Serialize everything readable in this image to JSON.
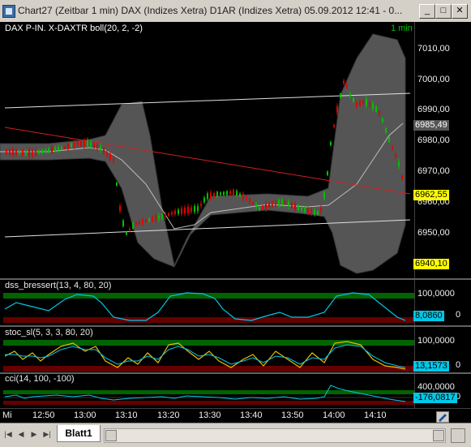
{
  "window": {
    "title": "Chart27 (Zeitbar 1 min)  DAX (Indizes Xetra) D1AR (Indizes Xetra) 05.09.2012 12:41 - 0...",
    "min_glyph": "_",
    "max_glyph": "□",
    "close_glyph": "✕"
  },
  "main_pane": {
    "label": "DAX P-IN. X-DAXTR boll(20, 2, -2)",
    "interval": "1 min",
    "ticks": [
      "7010,00",
      "7000,00",
      "6990,00",
      "6980,00",
      "6970,00",
      "6960,00",
      "6950,00"
    ],
    "flags": {
      "upper": "6985,49",
      "last": "6962,55",
      "lower": "6940,10"
    }
  },
  "dss_pane": {
    "label": "dss_bressert(13, 4, 80, 20)",
    "ticks": [
      "100,0000",
      "0"
    ],
    "value": "8,0860"
  },
  "stoc_pane": {
    "label": "stoc_sl(5, 3, 3, 80, 20)",
    "ticks": [
      "100,0000",
      "0"
    ],
    "value": "13,1573"
  },
  "cci_pane": {
    "label": "cci(14, 100, -100)",
    "ticks": [
      "400,0000",
      "0"
    ],
    "value": "-176,0817"
  },
  "time_axis": {
    "prefix": "Mi",
    "labels": [
      "12:50",
      "13:00",
      "13:10",
      "13:20",
      "13:30",
      "13:40",
      "13:50",
      "14:00",
      "14:10"
    ]
  },
  "tabs": {
    "sheet": "Blatt1",
    "nav": [
      "|◀",
      "◀",
      "▶",
      "▶|"
    ]
  },
  "colors": {
    "background": "#000000",
    "up_candle": "#00c000",
    "down_candle": "#e00000",
    "band": "#5a5a5a",
    "trend_red": "#d02020",
    "channel_white": "#e0e0e0",
    "osc_cyan": "#00c8e8",
    "osc_yellow": "#e8c000",
    "zone_green": "#006400",
    "zone_red": "#640000",
    "flag_yellow": "#ffff00"
  }
}
